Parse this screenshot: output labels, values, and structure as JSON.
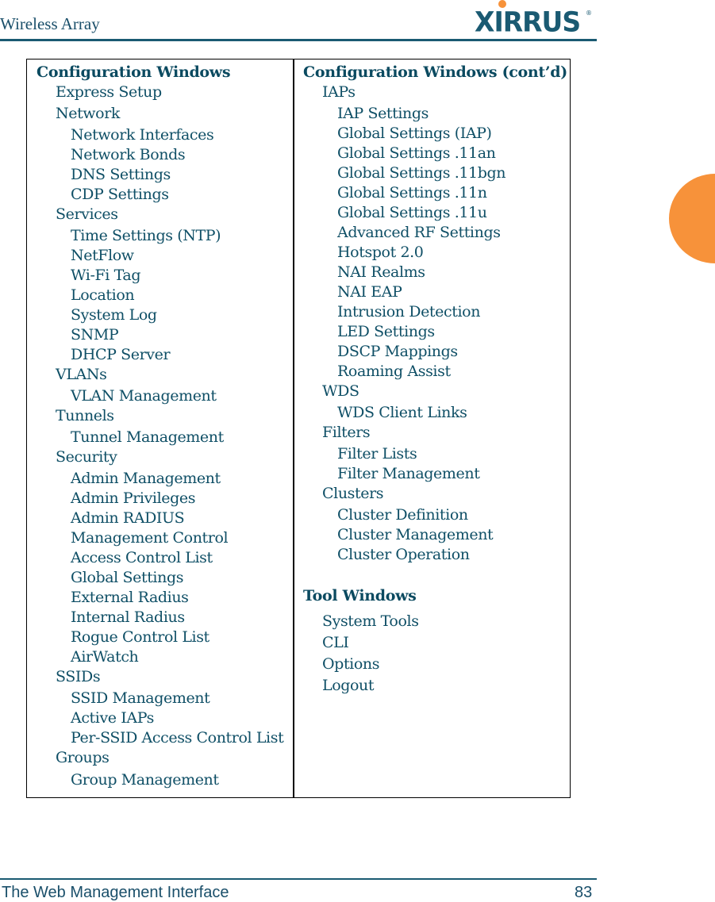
{
  "header": {
    "title": "Wireless Array",
    "logo_text": "XIRRUS",
    "logo_mark": "®"
  },
  "footer": {
    "title": "The Web Management Interface",
    "page_number": "83"
  },
  "colors": {
    "text": "#0f4f66",
    "rule": "#1a5a72",
    "accent_orange": "#f7923a"
  },
  "left_column": {
    "heading": "Configuration Windows",
    "items": [
      {
        "label": "Express Setup",
        "level": 1
      },
      {
        "label": "Network",
        "level": 1
      },
      {
        "label": "Network Interfaces",
        "level": 2
      },
      {
        "label": "Network Bonds",
        "level": 2
      },
      {
        "label": "DNS Settings",
        "level": 2
      },
      {
        "label": "CDP Settings",
        "level": 2
      },
      {
        "label": "Services",
        "level": 1
      },
      {
        "label": "Time Settings (NTP)",
        "level": 2
      },
      {
        "label": "NetFlow",
        "level": 2
      },
      {
        "label": "Wi-Fi Tag",
        "level": 2
      },
      {
        "label": "Location",
        "level": 2
      },
      {
        "label": "System Log",
        "level": 2
      },
      {
        "label": "SNMP",
        "level": 2
      },
      {
        "label": "DHCP Server",
        "level": 2
      },
      {
        "label": "VLANs",
        "level": 1
      },
      {
        "label": "VLAN Management",
        "level": 2
      },
      {
        "label": "Tunnels",
        "level": 1
      },
      {
        "label": "Tunnel Management",
        "level": 2
      },
      {
        "label": "Security",
        "level": 1
      },
      {
        "label": "Admin Management",
        "level": 2
      },
      {
        "label": "Admin Privileges",
        "level": 2
      },
      {
        "label": "Admin RADIUS",
        "level": 2
      },
      {
        "label": "Management Control",
        "level": 2
      },
      {
        "label": "Access Control List",
        "level": 2
      },
      {
        "label": "Global Settings",
        "level": 2
      },
      {
        "label": "External Radius",
        "level": 2
      },
      {
        "label": "Internal Radius",
        "level": 2
      },
      {
        "label": "Rogue Control List",
        "level": 2
      },
      {
        "label": "AirWatch",
        "level": 2
      },
      {
        "label": "SSIDs",
        "level": 1
      },
      {
        "label": "SSID Management",
        "level": 2
      },
      {
        "label": "Active IAPs",
        "level": 2
      },
      {
        "label": "Per-SSID Access Control List",
        "level": 2
      },
      {
        "label": "Groups",
        "level": 1
      },
      {
        "label": "Group Management",
        "level": 2
      }
    ]
  },
  "right_column": {
    "heading": "Configuration Windows (cont’d)",
    "items": [
      {
        "label": "IAPs",
        "level": 1
      },
      {
        "label": "IAP Settings",
        "level": 2
      },
      {
        "label": "Global Settings (IAP)",
        "level": 2
      },
      {
        "label": "Global Settings .11an",
        "level": 2
      },
      {
        "label": "Global Settings .11bgn",
        "level": 2
      },
      {
        "label": "Global Settings .11n",
        "level": 2
      },
      {
        "label": "Global Settings .11u",
        "level": 2
      },
      {
        "label": "Advanced RF Settings",
        "level": 2
      },
      {
        "label": "Hotspot 2.0",
        "level": 2
      },
      {
        "label": "NAI Realms",
        "level": 2
      },
      {
        "label": "NAI EAP",
        "level": 2
      },
      {
        "label": "Intrusion Detection",
        "level": 2
      },
      {
        "label": "LED Settings",
        "level": 2
      },
      {
        "label": "DSCP Mappings",
        "level": 2
      },
      {
        "label": "Roaming Assist",
        "level": 2
      },
      {
        "label": "WDS",
        "level": 1
      },
      {
        "label": "WDS Client Links",
        "level": 2
      },
      {
        "label": "Filters",
        "level": 1
      },
      {
        "label": "Filter Lists",
        "level": 2
      },
      {
        "label": "Filter Management",
        "level": 2
      },
      {
        "label": "Clusters",
        "level": 1
      },
      {
        "label": "Cluster Definition",
        "level": 2
      },
      {
        "label": "Cluster Management",
        "level": 2
      },
      {
        "label": "Cluster Operation",
        "level": 2
      }
    ],
    "tool_heading": "Tool Windows",
    "tool_items": [
      {
        "label": "System Tools",
        "level": 1
      },
      {
        "label": "CLI",
        "level": 1
      },
      {
        "label": "Options",
        "level": 1
      },
      {
        "label": "Logout",
        "level": 1
      }
    ]
  }
}
